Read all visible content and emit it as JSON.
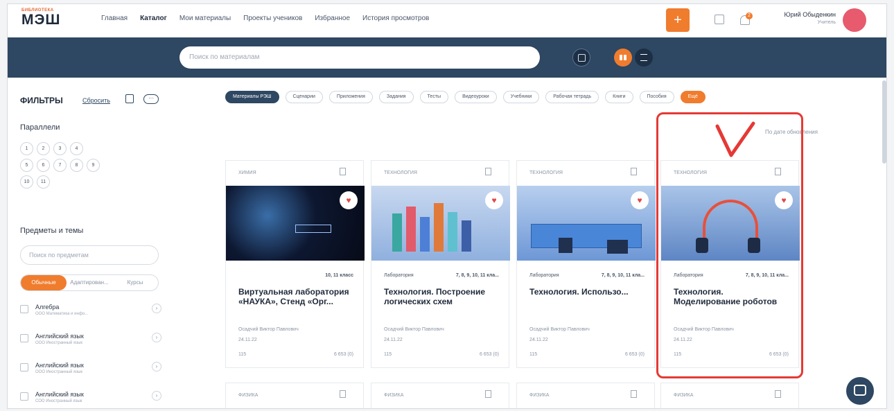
{
  "logo": {
    "small": "БИБЛИОТЕКА",
    "big": "МЭШ"
  },
  "nav": [
    "Главная",
    "Каталог",
    "Мои материалы",
    "Проекты учеников",
    "Избранное",
    "История просмотров"
  ],
  "header": {
    "plus": "+",
    "notifications": "2",
    "user_name": "Юрий Обыденкин",
    "user_role": "Учитель"
  },
  "search": {
    "placeholder": "Поиск по материалам"
  },
  "filters": {
    "title": "ФИЛЬТРЫ",
    "reset": "Сбросить",
    "grades_title": "Параллели",
    "grades": [
      "1",
      "2",
      "3",
      "4",
      "5",
      "6",
      "7",
      "8",
      "9",
      "10",
      "11"
    ],
    "subjects_title": "Предметы и темы",
    "subjects_placeholder": "Поиск по предметам",
    "segments": [
      "Обычные",
      "Адаптирован...",
      "Курсы"
    ],
    "subjects": [
      {
        "name": "Алгебра",
        "sub": "ООО Математика и инфо..."
      },
      {
        "name": "Английский язык",
        "sub": "ООО Иностранный язык"
      },
      {
        "name": "Английский язык",
        "sub": "ООО Иностранный язык"
      },
      {
        "name": "Английский язык",
        "sub": "СОО Иностранный язык"
      }
    ]
  },
  "chips": [
    "Материалы РЭШ",
    "Сценарии",
    "Приложения",
    "Задания",
    "Тесты",
    "Видеоуроки",
    "Учебники",
    "Рабочая тетрадь",
    "Книги",
    "Пособия",
    "Ещё"
  ],
  "sort": "По дате обновления",
  "cards": [
    {
      "category": "ХИМИЯ",
      "lab": "",
      "classes": "10, 11 класс",
      "title": "Виртуальная лаборатория «НАУКА», Стенд «Орг...",
      "author": "Осадчий Виктор Павлович",
      "date": "24.11.22",
      "likes": "115",
      "views": "6 653 (0)"
    },
    {
      "category": "ТЕХНОЛОГИЯ",
      "lab": "Лаборатория",
      "classes": "7, 8, 9, 10, 11 кла...",
      "title": "Технология. Построение логических схем",
      "author": "Осадчий Виктор Павлович",
      "date": "24.11.22",
      "likes": "115",
      "views": "6 653 (0)"
    },
    {
      "category": "ТЕХНОЛОГИЯ",
      "lab": "Лаборатория",
      "classes": "7, 8, 9, 10, 11 кла...",
      "title": "Технология. Использо...",
      "author": "Осадчий Виктор Павлович",
      "date": "24.11.22",
      "likes": "115",
      "views": "6 653 (0)"
    },
    {
      "category": "ТЕХНОЛОГИЯ",
      "lab": "Лаборатория",
      "classes": "7, 8, 9, 10, 11 кла...",
      "title": "Технология. Моделирование роботов",
      "author": "Осадчий Виктор Павлович",
      "date": "24.11.22",
      "likes": "115",
      "views": "6 653 (0)"
    }
  ],
  "cards_row2": [
    "ФИЗИКА",
    "ФИЗИКА",
    "ФИЗИКА",
    "ФИЗИКА"
  ],
  "colors": {
    "accent": "#f07c2d",
    "navy": "#2e4762",
    "highlight": "#e53935"
  }
}
